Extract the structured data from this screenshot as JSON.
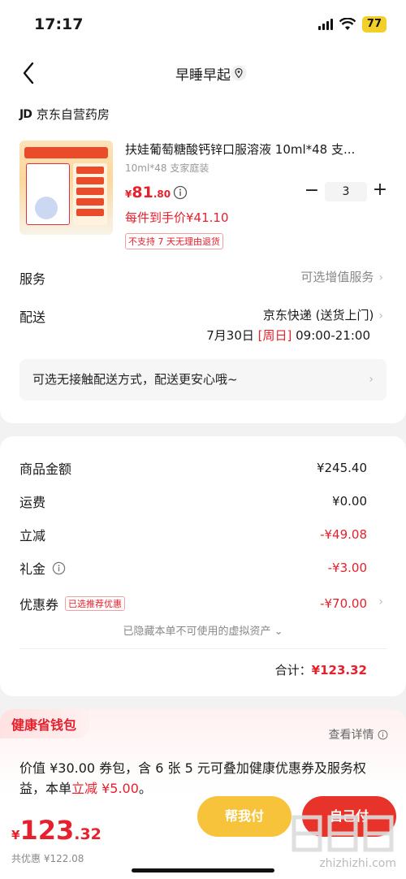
{
  "status": {
    "time": "17:17",
    "battery": "77"
  },
  "nav": {
    "title": "早睡早起"
  },
  "store": {
    "logo": "JD",
    "name": "京东自营药房"
  },
  "product": {
    "name": "扶娃葡萄糖酸钙锌口服溶液 10ml*48 支...",
    "spec": "10ml*48 支家庭装",
    "price_symbol": "¥",
    "price_int": "81",
    "price_dec": ".80",
    "quantity": "3",
    "minus_label": "−",
    "plus_label": "+",
    "unit_price": "每件到手价¥41.10",
    "no_return": "不支持 7 天无理由退货"
  },
  "service": {
    "label": "服务",
    "value": "可选增值服务"
  },
  "delivery": {
    "label": "配送",
    "value": "京东快递 (送货上门)",
    "date": "7月30日 ",
    "weekday": "[周日]",
    "time": " 09:00-21:00",
    "contactless": "可选无接触配送方式，配送更安心哦~"
  },
  "fees": {
    "goods_label": "商品金额",
    "goods_value": "¥245.40",
    "shipping_label": "运费",
    "shipping_value": "¥0.00",
    "discount_label": "立减",
    "discount_value": "-¥49.08",
    "gift_label": "礼金",
    "gift_value": "-¥3.00",
    "coupon_label": "优惠券",
    "coupon_tag": "已选推荐优惠",
    "coupon_value": "-¥70.00",
    "hidden_assets": "已隐藏本单不可使用的虚拟资产",
    "total_label": "合计：",
    "total_value": "¥123.32"
  },
  "health": {
    "tag": "健康省钱包",
    "see_detail": "查看详情",
    "promo_part1": "价值 ¥30.00 券包，含 6 张 5 元可叠加健康优惠券及服务权益，本单",
    "promo_red": "立减 ¥5.00",
    "promo_end": "。"
  },
  "footer": {
    "total_symbol": "¥",
    "total_int": "123",
    "total_dec": ".32",
    "saved": "共优惠 ¥122.08",
    "pay_friend": "帮我付",
    "pay_self": "自己付",
    "watermark_text": "zhizhizhi.com"
  },
  "colors": {
    "accent": "#e6202d",
    "pay_friend": "#f6c33a",
    "pay_self": "#e8332b"
  }
}
